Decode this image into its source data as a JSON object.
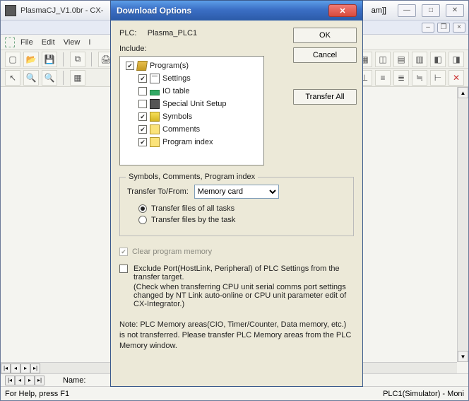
{
  "main_window": {
    "title": "PlasmaCJ_V1.0br - CX-",
    "title_right": "am]]",
    "menu": {
      "file": "File",
      "edit": "Edit",
      "view": "View",
      "ins": "I"
    },
    "status_name_label": "Name:",
    "status_help": "For Help, press F1",
    "status_right": "PLC1(Simulator) - Moni"
  },
  "dialog": {
    "title": "Download Options",
    "plc_label": "PLC:",
    "plc_value": "Plasma_PLC1",
    "buttons": {
      "ok": "OK",
      "cancel": "Cancel",
      "transfer_all": "Transfer All"
    },
    "include_label": "Include:",
    "tree": [
      {
        "label": "Program(s)",
        "checked": true,
        "icon": "programs"
      },
      {
        "label": "Settings",
        "checked": true,
        "icon": "settings"
      },
      {
        "label": "IO table",
        "checked": false,
        "icon": "io"
      },
      {
        "label": "Special Unit Setup",
        "checked": false,
        "icon": "sus"
      },
      {
        "label": "Symbols",
        "checked": true,
        "icon": "sym"
      },
      {
        "label": "Comments",
        "checked": true,
        "icon": "com"
      },
      {
        "label": "Program index",
        "checked": true,
        "icon": "prg"
      }
    ],
    "group_legend": "Symbols, Comments, Program index",
    "transfer_label": "Transfer To/From:",
    "transfer_value": "Memory card",
    "radio_all": "Transfer files of all tasks",
    "radio_by": "Transfer files by the task",
    "clear_label": "Clear program memory",
    "exclude_line1": "Exclude Port(HostLink, Peripheral) of PLC Settings from the transfer target.",
    "exclude_line2": "(Check when transferring CPU unit serial comms port settings changed by NT Link auto-online or CPU unit parameter edit of CX-Integrator.)",
    "note": "Note: PLC Memory areas(CIO, Timer/Counter, Data memory, etc.) is not transferred. Please transfer PLC Memory areas from the PLC Memory window."
  }
}
